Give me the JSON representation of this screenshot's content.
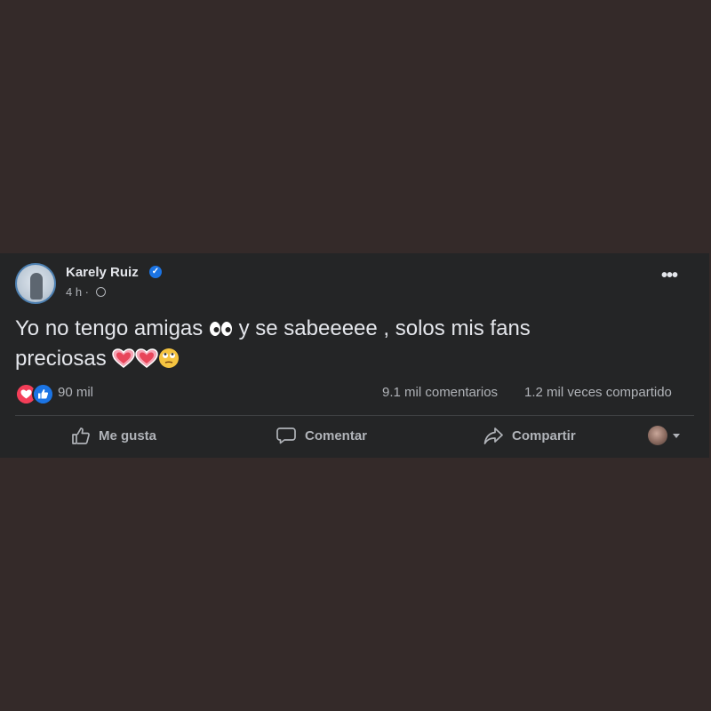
{
  "post": {
    "author": "Karely Ruiz",
    "verified": true,
    "timestamp": "4 h ·",
    "privacy_icon": "globe-icon",
    "more_icon": "more-horizontal-icon",
    "text_part1": "Yo no tengo amigas",
    "text_part2": "y se sabeeeee , solos mis fans",
    "text_part3": "preciosas",
    "emojis": [
      "eyes",
      "heart",
      "heart",
      "face-with-rolling-eyes"
    ],
    "reactions": {
      "types": [
        "love",
        "like"
      ],
      "count": "90 mil"
    },
    "comments_count": "9.1 mil comentarios",
    "shares_count": "1.2 mil veces compartido"
  },
  "actions": {
    "like": "Me gusta",
    "comment": "Comentar",
    "share": "Compartir"
  },
  "colors": {
    "page_bg": "#342a29",
    "card_bg": "#242526",
    "text_primary": "#e4e6eb",
    "text_secondary": "#b0b3b8",
    "like_blue": "#1b74e4",
    "love_red": "#f33e58"
  }
}
